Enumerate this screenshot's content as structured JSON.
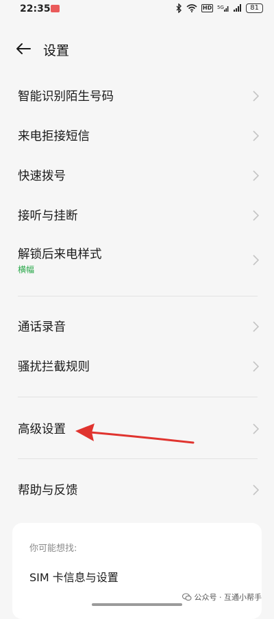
{
  "status_bar": {
    "time": "22:35",
    "hd_label": "HD",
    "battery": "81"
  },
  "header": {
    "title": "设置"
  },
  "menu": {
    "items": [
      {
        "label": "智能识别陌生号码"
      },
      {
        "label": "来电拒接短信"
      },
      {
        "label": "快速拨号"
      },
      {
        "label": "接听与挂断"
      },
      {
        "label": "解锁后来电样式",
        "sub": "横幅"
      },
      {
        "label": "通话录音"
      },
      {
        "label": "骚扰拦截规则"
      },
      {
        "label": "高级设置"
      },
      {
        "label": "帮助与反馈"
      }
    ]
  },
  "suggestions": {
    "title": "你可能想找:",
    "items": [
      {
        "label": "SIM 卡信息与设置"
      }
    ]
  },
  "watermark": {
    "text": "公众号 · 互通小帮手"
  },
  "colors": {
    "background": "#f6f6f6",
    "accent_green": "#2aa84a",
    "annotation_red": "#e0342f"
  }
}
